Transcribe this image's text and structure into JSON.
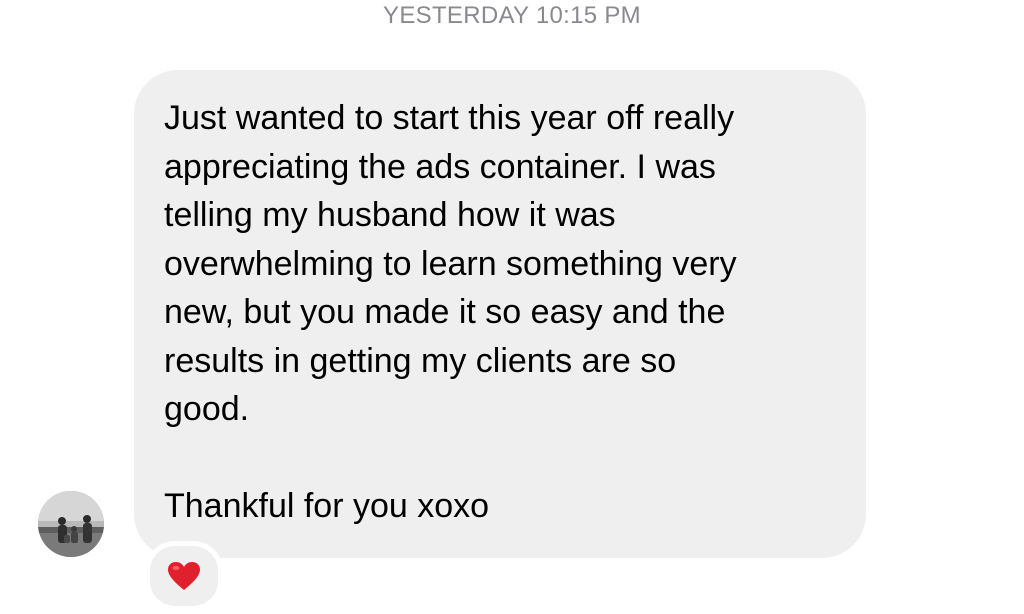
{
  "thread": {
    "timestamp": "YESTERDAY 10:15 PM"
  },
  "message": {
    "paragraphs": [
      "Just wanted to start this year off really\nappreciating the ads container. I was\ntelling my husband how it was\noverwhelming to learn something very\nnew, but you made it so easy and the\nresults in getting my clients are so\ngood.",
      "Thankful for you xoxo"
    ],
    "reaction": "heart-icon"
  },
  "colors": {
    "bubble": "#efeff0",
    "timestamp": "#8a8a8e",
    "reaction_heart": "#e0202c"
  }
}
